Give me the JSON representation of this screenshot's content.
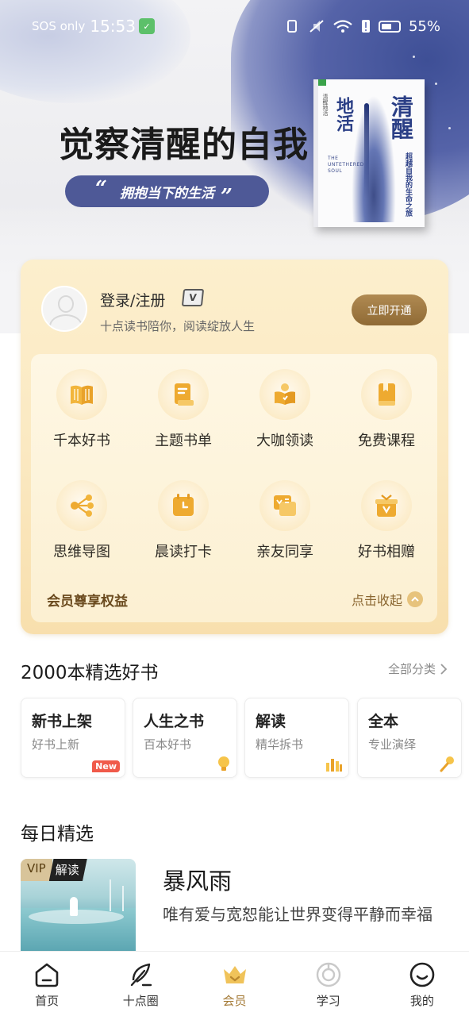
{
  "status_bar": {
    "carrier": "SOS only",
    "time": "15:53",
    "battery": "55%"
  },
  "banner": {
    "title": "觉察清醒的自我",
    "slogan": "拥抱当下的生活",
    "book": {
      "title_left": "地活",
      "title_left_small": "清醒地活",
      "title_right": "清醒",
      "subtitle": "超越自我的生命之旅",
      "english": "THE UNTETHERED SOUL"
    }
  },
  "member": {
    "login_label": "登录/注册",
    "vip_chip": "V",
    "subtitle": "十点读书陪你，阅读绽放人生",
    "open_button": "立即开通",
    "benefits": [
      {
        "label": "千本好书",
        "icon": "open-book-icon"
      },
      {
        "label": "主题书单",
        "icon": "booklist-icon"
      },
      {
        "label": "大咖领读",
        "icon": "lead-reading-icon"
      },
      {
        "label": "免费课程",
        "icon": "course-book-icon"
      },
      {
        "label": "思维导图",
        "icon": "mind-map-icon"
      },
      {
        "label": "晨读打卡",
        "icon": "clock-checkin-icon"
      },
      {
        "label": "亲友同享",
        "icon": "share-icon"
      },
      {
        "label": "好书相赠",
        "icon": "gift-icon"
      }
    ],
    "footer_title": "会员尊享权益",
    "footer_action": "点击收起"
  },
  "selected_books": {
    "title": "2000本精选好书",
    "all_link": "全部分类",
    "categories": [
      {
        "title": "新书上架",
        "sub": "好书上新",
        "deco": "New"
      },
      {
        "title": "人生之书",
        "sub": "百本好书",
        "deco": "bulb-icon"
      },
      {
        "title": "解读",
        "sub": "精华拆书",
        "deco": "bars-icon"
      },
      {
        "title": "全本",
        "sub": "专业演绎",
        "deco": "microphone-icon"
      }
    ]
  },
  "daily": {
    "title": "每日精选",
    "vip": "VIP",
    "tag": "解读",
    "book_title": "暴风雨",
    "description": "唯有爱与宽恕能让世界变得平静而幸福"
  },
  "tabs": [
    {
      "label": "首页",
      "icon": "home-icon"
    },
    {
      "label": "十点圈",
      "icon": "feather-icon"
    },
    {
      "label": "会员",
      "icon": "crown-icon",
      "active": true
    },
    {
      "label": "学习",
      "icon": "target-icon"
    },
    {
      "label": "我的",
      "icon": "smile-icon"
    }
  ],
  "colors": {
    "accent_gold": "#a47a36",
    "banner_pill": "#4e5997",
    "card_bg": "#fcefcd"
  }
}
